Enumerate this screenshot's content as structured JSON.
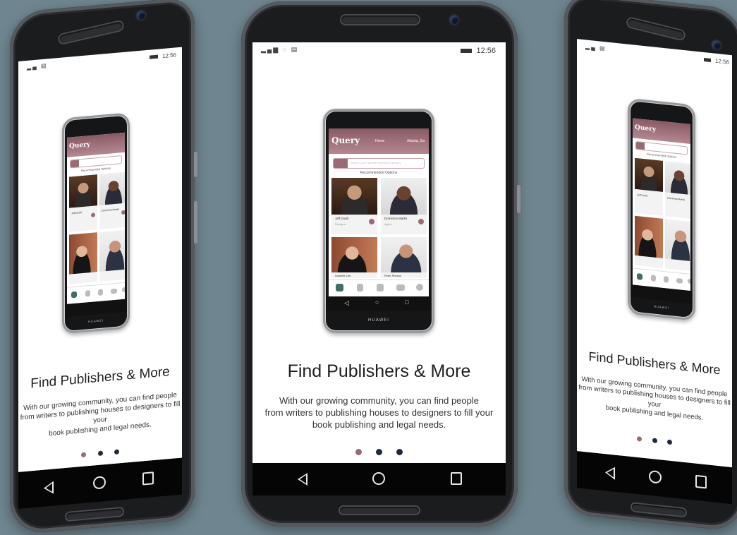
{
  "status": {
    "time": "12:56"
  },
  "onboarding": {
    "title": "Find Publishers & More",
    "body_line1": "With our growing community, you can find people",
    "body_line2": "from writers to publishing houses to designers to fill your",
    "body_line3": "book publishing and legal needs.",
    "dots": [
      {
        "state": "active",
        "color": "#9a6b74"
      },
      {
        "state": "inactive",
        "color": "#1e2a3c"
      },
      {
        "state": "inactive",
        "color": "#1e2a3c"
      }
    ]
  },
  "mini_app": {
    "logo": "Query",
    "nav_home": "Home",
    "location": "Atlanta, Ga",
    "search_placeholder": "Search User Name/Profession/Category",
    "section_caption": "Recommended Options",
    "cards": [
      {
        "name": "Jeff Dodd",
        "role": "Designer"
      },
      {
        "name": "Dominica Marks",
        "role": "Agent"
      },
      {
        "name": "Danielle Lee",
        "role": ""
      },
      {
        "name": "Peter Pierson",
        "role": ""
      }
    ],
    "brand": "HUAWEI"
  },
  "colors": {
    "accent": "#9a6b74",
    "background": "#6f8690",
    "dot_inactive": "#1e2a3c"
  },
  "icons": [
    "back-icon",
    "home-icon",
    "recents-icon",
    "signal-icon",
    "wifi-icon",
    "message-icon",
    "battery-icon"
  ]
}
